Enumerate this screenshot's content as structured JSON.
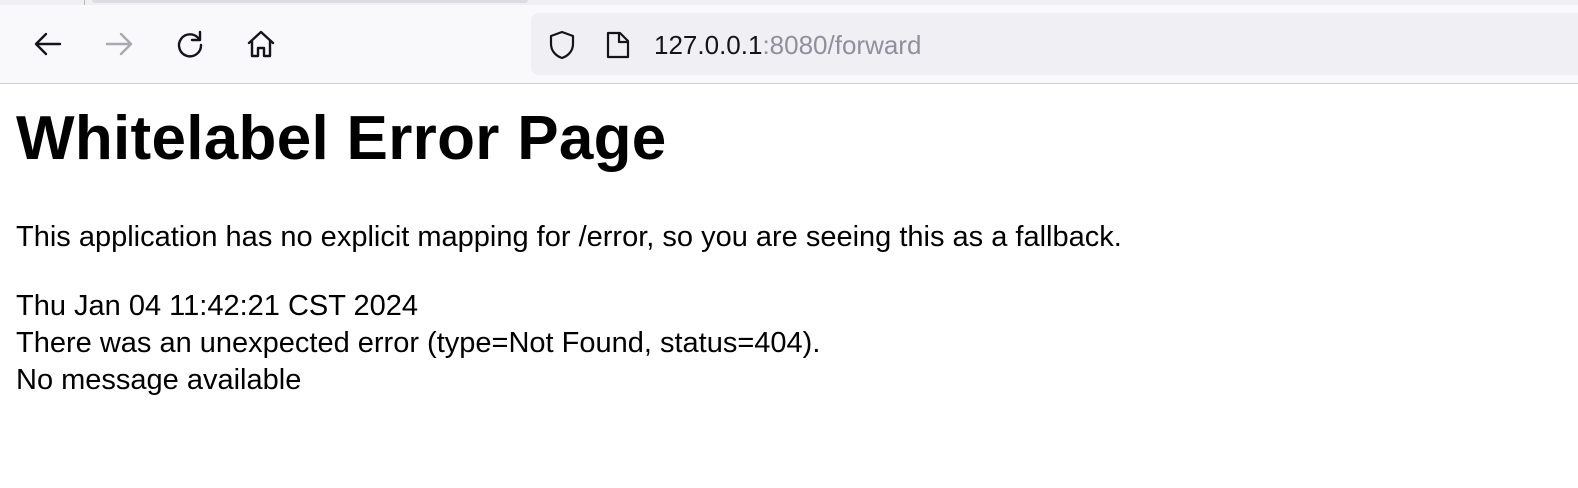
{
  "browser": {
    "url_host": "127.0.0.1",
    "url_rest": ":8080/forward",
    "icons": {
      "back": "arrow-left-icon",
      "forward": "arrow-right-icon",
      "reload": "reload-icon",
      "home": "home-icon",
      "security": "shield-icon",
      "page": "page-icon"
    }
  },
  "page": {
    "title": "Whitelabel Error Page",
    "fallback_message": "This application has no explicit mapping for /error, so you are seeing this as a fallback.",
    "timestamp": "Thu Jan 04 11:42:21 CST 2024",
    "error_line": "There was an unexpected error (type=Not Found, status=404).",
    "detail_message": "No message available"
  }
}
